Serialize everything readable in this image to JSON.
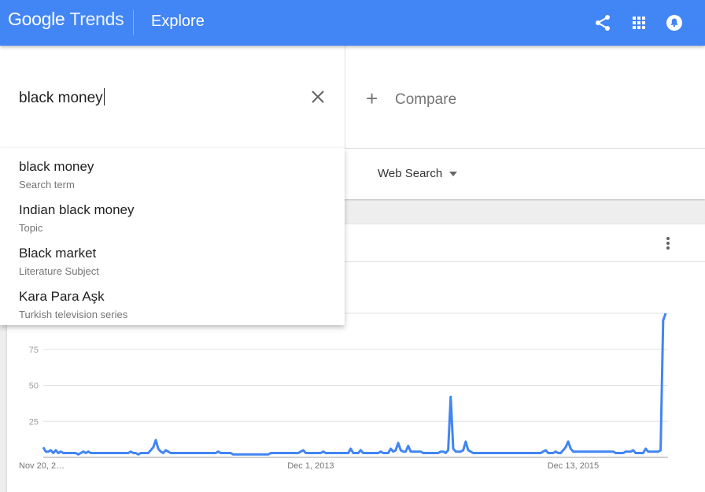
{
  "header": {
    "logo_google": "Google",
    "logo_trends": "Trends",
    "section": "Explore",
    "icons": [
      "share-icon",
      "apps-icon",
      "notifications-icon"
    ],
    "color": "#4285f4"
  },
  "search": {
    "value": "black money",
    "clear_icon": "close-icon"
  },
  "compare": {
    "plus": "+",
    "label": "Compare"
  },
  "filters": {
    "property": "Web Search"
  },
  "suggestions": [
    {
      "title": "black money",
      "type": "Search term"
    },
    {
      "title": "Indian black money",
      "type": "Topic"
    },
    {
      "title": "Black market",
      "type": "Literature Subject"
    },
    {
      "title": "Kara Para Aşk",
      "type": "Turkish television series"
    }
  ],
  "chart_data": {
    "type": "line",
    "series_color": "#4285f4",
    "y_ticks": [
      25,
      50,
      75
    ],
    "ylim": [
      0,
      100
    ],
    "x_tick_labels": [
      "Nov 20, 2…",
      "Dec 1, 2013",
      "Dec 13, 2015"
    ],
    "x_tick_index": [
      0,
      107,
      212
    ],
    "grid": true,
    "values": [
      7,
      4,
      4,
      5,
      3,
      5,
      3,
      4,
      3,
      3,
      3,
      3,
      3,
      3,
      2,
      3,
      4,
      3,
      4,
      3,
      3,
      3,
      3,
      3,
      3,
      3,
      3,
      3,
      3,
      3,
      3,
      3,
      3,
      3,
      3,
      4,
      3,
      3,
      2,
      3,
      3,
      3,
      3,
      5,
      7,
      12,
      6,
      4,
      3,
      5,
      4,
      3,
      3,
      3,
      3,
      3,
      3,
      3,
      3,
      3,
      3,
      3,
      3,
      3,
      3,
      3,
      3,
      3,
      3,
      3,
      4,
      3,
      3,
      3,
      3,
      3,
      2,
      2,
      2,
      2,
      2,
      2,
      2,
      2,
      2,
      2,
      2,
      2,
      2,
      2,
      2,
      3,
      3,
      3,
      3,
      3,
      3,
      3,
      3,
      3,
      3,
      3,
      3,
      4,
      5,
      3,
      3,
      3,
      3,
      3,
      3,
      3,
      4,
      3,
      3,
      3,
      3,
      3,
      3,
      3,
      3,
      3,
      3,
      6,
      3,
      3,
      3,
      5,
      3,
      3,
      3,
      3,
      3,
      3,
      3,
      4,
      3,
      3,
      3,
      6,
      4,
      5,
      10,
      5,
      4,
      4,
      8,
      4,
      4,
      4,
      4,
      4,
      3,
      3,
      3,
      3,
      3,
      3,
      3,
      4,
      4,
      3,
      5,
      42,
      6,
      4,
      4,
      4,
      5,
      11,
      5,
      4,
      3,
      3,
      3,
      3,
      3,
      3,
      3,
      3,
      3,
      3,
      3,
      3,
      3,
      3,
      3,
      3,
      3,
      3,
      3,
      3,
      3,
      3,
      3,
      3,
      3,
      3,
      3,
      3,
      4,
      5,
      3,
      3,
      3,
      4,
      3,
      3,
      5,
      7,
      11,
      6,
      4,
      4,
      4,
      4,
      4,
      4,
      4,
      4,
      4,
      4,
      4,
      4,
      4,
      4,
      4,
      4,
      4,
      3,
      3,
      3,
      3,
      4,
      4,
      4,
      5,
      3,
      3,
      3,
      3,
      6,
      4,
      4,
      4,
      4,
      4,
      5,
      95,
      100
    ]
  }
}
